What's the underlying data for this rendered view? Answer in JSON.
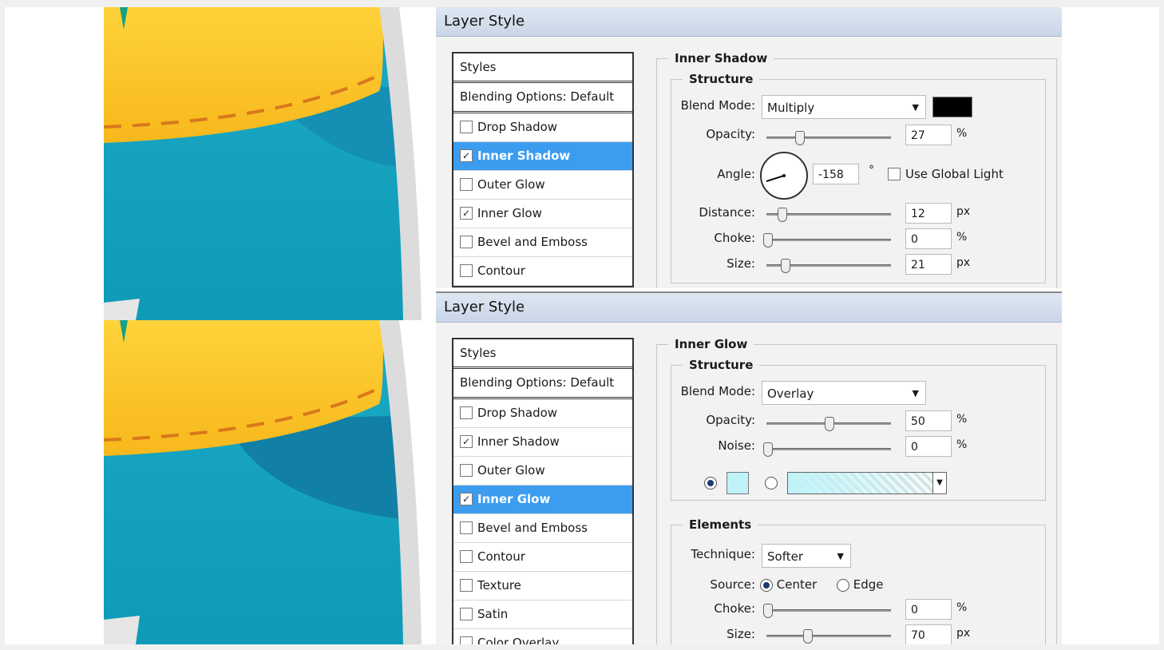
{
  "top_dialog": {
    "title": "Layer Style",
    "styles_header": "Styles",
    "blending_options": "Blending Options: Default",
    "style_items": [
      {
        "label": "Drop Shadow",
        "checked": false,
        "selected": false
      },
      {
        "label": "Inner Shadow",
        "checked": true,
        "selected": true
      },
      {
        "label": "Outer Glow",
        "checked": false,
        "selected": false
      },
      {
        "label": "Inner Glow",
        "checked": true,
        "selected": false
      },
      {
        "label": "Bevel and Emboss",
        "checked": false,
        "selected": false
      },
      {
        "label": "Contour",
        "checked": false,
        "selected": false
      }
    ],
    "section_title": "Inner Shadow",
    "structure_title": "Structure",
    "blend_mode_label": "Blend Mode:",
    "blend_mode_value": "Multiply",
    "shadow_color": "#000000",
    "opacity_label": "Opacity:",
    "opacity_value": "27",
    "opacity_unit": "%",
    "angle_label": "Angle:",
    "angle_value": "-158",
    "angle_unit": "°",
    "global_light_label": "Use Global Light",
    "global_light_checked": false,
    "distance_label": "Distance:",
    "distance_value": "12",
    "distance_unit": "px",
    "choke_label": "Choke:",
    "choke_value": "0",
    "choke_unit": "%",
    "size_label": "Size:",
    "size_value": "21",
    "size_unit": "px"
  },
  "bottom_dialog": {
    "title": "Layer Style",
    "styles_header": "Styles",
    "blending_options": "Blending Options: Default",
    "style_items": [
      {
        "label": "Drop Shadow",
        "checked": false,
        "selected": false
      },
      {
        "label": "Inner Shadow",
        "checked": true,
        "selected": false
      },
      {
        "label": "Outer Glow",
        "checked": false,
        "selected": false
      },
      {
        "label": "Inner Glow",
        "checked": true,
        "selected": true
      },
      {
        "label": "Bevel and Emboss",
        "checked": false,
        "selected": false
      },
      {
        "label": "Contour",
        "checked": false,
        "selected": false
      },
      {
        "label": "Texture",
        "checked": false,
        "selected": false
      },
      {
        "label": "Satin",
        "checked": false,
        "selected": false
      },
      {
        "label": "Color Overlay",
        "checked": false,
        "selected": false
      }
    ],
    "section_title": "Inner Glow",
    "structure_title": "Structure",
    "blend_mode_label": "Blend Mode:",
    "blend_mode_value": "Overlay",
    "opacity_label": "Opacity:",
    "opacity_value": "50",
    "opacity_unit": "%",
    "noise_label": "Noise:",
    "noise_value": "0",
    "noise_unit": "%",
    "glow_color": "#bff3f8",
    "elements_title": "Elements",
    "technique_label": "Technique:",
    "technique_value": "Softer",
    "source_label": "Source:",
    "source_center_label": "Center",
    "source_edge_label": "Edge",
    "choke_label": "Choke:",
    "choke_value": "0",
    "choke_unit": "%",
    "size_label": "Size:",
    "size_value": "70",
    "size_unit": "px"
  },
  "colors": {
    "selection": "#3b9cf0",
    "fabric_teal": "#19a8c2",
    "pocket_yellow": "#fdc52c",
    "stitch_orange": "#d9781c"
  }
}
